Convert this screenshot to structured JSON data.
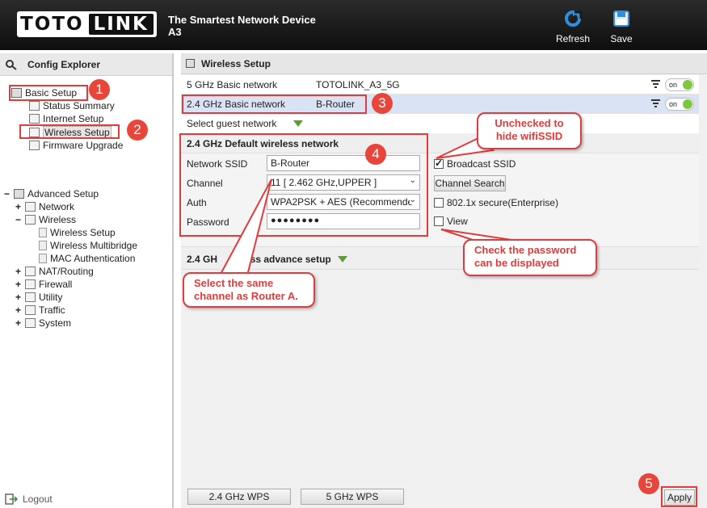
{
  "header": {
    "logo_left": "TOTO",
    "logo_right": "LINK",
    "tagline": "The Smartest Network Device",
    "model": "A3",
    "refresh_label": "Refresh",
    "save_label": "Save"
  },
  "left": {
    "title": "Config Explorer",
    "basic_setup": "Basic Setup",
    "basic_items": [
      "Status Summary",
      "Internet Setup",
      "Wireless Setup",
      "Firmware Upgrade"
    ],
    "advanced_setup": "Advanced Setup",
    "network": "Network",
    "wireless": "Wireless",
    "wireless_items": [
      "Wireless Setup",
      "Wireless Multibridge",
      "MAC Authentication"
    ],
    "advanced_items": [
      "NAT/Routing",
      "Firewall",
      "Utility",
      "Traffic",
      "System"
    ],
    "logout": "Logout"
  },
  "right": {
    "title": "Wireless Setup",
    "row5g_label": "5 GHz Basic network",
    "row5g_value": "TOTOLINK_A3_5G",
    "row24_label": "2.4 GHz Basic network",
    "row24_value": "B-Router",
    "toggle_label": "on",
    "guest_label": "Select guest network",
    "default_section_title": "2.4 GHz Default wireless network",
    "ssid_label": "Network SSID",
    "ssid_value": "B-Router",
    "channel_label": "Channel",
    "channel_value": "11 [ 2.462 GHz,UPPER ]",
    "auth_label": "Auth",
    "auth_value": "WPA2PSK + AES (Recommende",
    "password_label": "Password",
    "password_value": "●●●●●●●●",
    "broadcast_label": "Broadcast SSID",
    "broadcast_checked": true,
    "channel_search_label": "Channel Search",
    "secure_label": "802.1x secure(Enterprise)",
    "view_label": "View",
    "advance_title_a": "2.4 GH",
    "advance_title_b": "ireless advance setup",
    "wps24_label": "2.4 GHz WPS",
    "wps5_label": "5 GHz WPS",
    "apply_label": "Apply"
  },
  "annotations": {
    "n1": "1",
    "n2": "2",
    "n3": "3",
    "n4": "4",
    "n5": "5",
    "callout_ssid": "Unchecked to\nhide wifiSSID",
    "callout_channel": "Select the same\nchannel as Router A.",
    "callout_password": "Check the password\ncan be displayed"
  },
  "colors": {
    "annotation": "#e03c3c",
    "toggle_on": "#7fc640",
    "selected_row": "#d9e3f3"
  }
}
